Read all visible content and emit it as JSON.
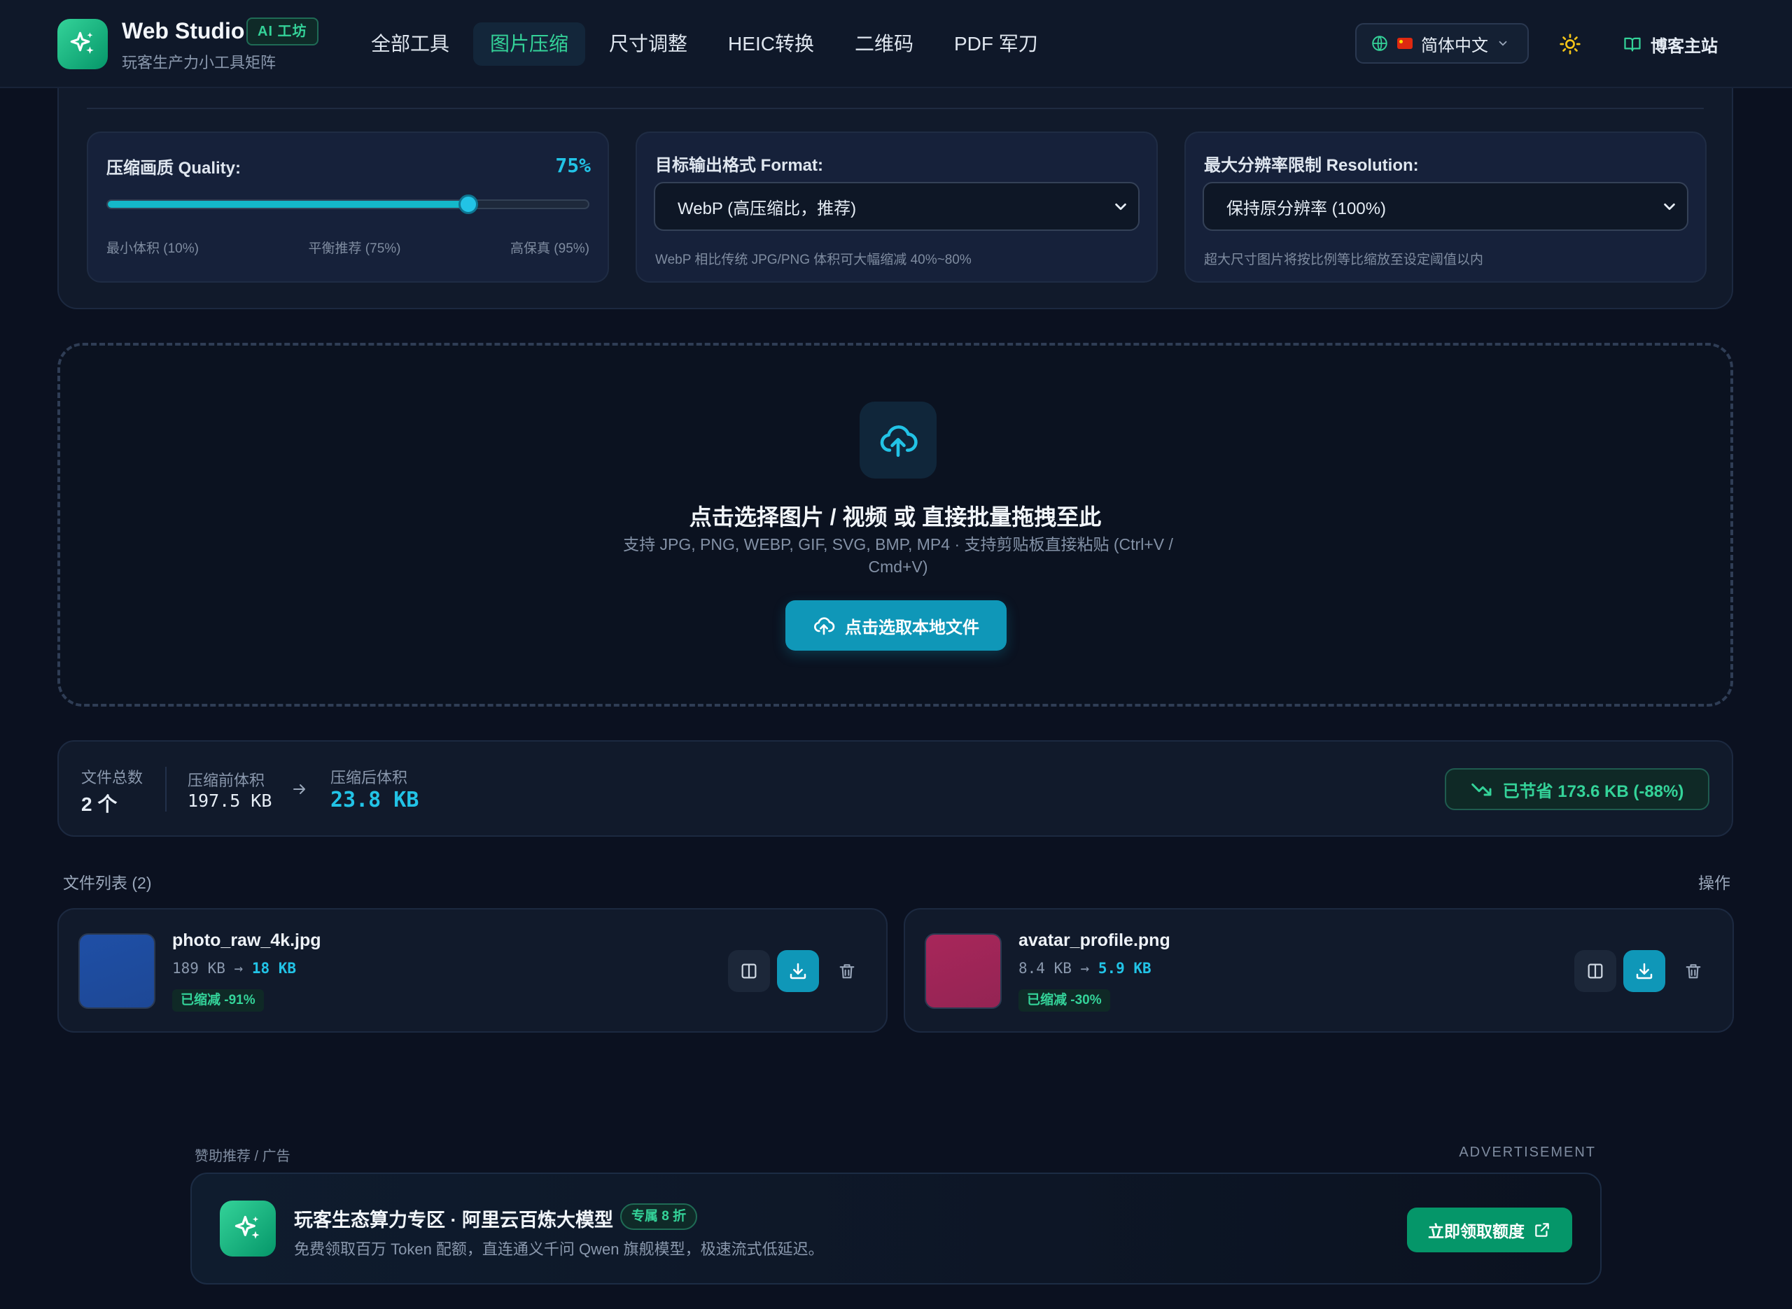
{
  "colors": {
    "background": "#0b1120",
    "accent_green": "#34d399",
    "accent_cyan": "#22c3e6",
    "primary_button": "#0f97b8"
  },
  "header": {
    "brand_title": "Web Studio",
    "brand_badge": "AI 工坊",
    "brand_subtitle": "玩客生产力小工具矩阵",
    "nav": [
      {
        "label": "全部工具",
        "active": false
      },
      {
        "label": "图片压缩",
        "active": true
      },
      {
        "label": "尺寸调整",
        "active": false
      },
      {
        "label": "HEIC转换",
        "active": false
      },
      {
        "label": "二维码",
        "active": false
      },
      {
        "label": "PDF 军刀",
        "active": false
      }
    ],
    "language": "简体中文",
    "blog_link": "博客主站"
  },
  "settings": {
    "quality": {
      "label": "压缩画质 Quality:",
      "value_text": "75%",
      "value": 75,
      "min_label": "最小体积 (10%)",
      "mid_label": "平衡推荐 (75%)",
      "max_label": "高保真 (95%)"
    },
    "format": {
      "label": "目标输出格式 Format:",
      "selected": "WebP (高压缩比，推荐)",
      "hint": "WebP 相比传统 JPG/PNG 体积可大幅缩减 40%~80%"
    },
    "resolution": {
      "label": "最大分辨率限制 Resolution:",
      "selected": "保持原分辨率 (100%)",
      "hint": "超大尺寸图片将按比例等比缩放至设定阈值以内"
    }
  },
  "dropzone": {
    "title": "点击选择图片 / 视频 或 直接批量拖拽至此",
    "subtitle": "支持 JPG, PNG, WEBP, GIF, SVG, BMP, MP4 · 支持剪贴板直接粘贴 (Ctrl+V / Cmd+V)",
    "button": "点击选取本地文件"
  },
  "stats": {
    "total_label": "文件总数",
    "total_value": "2 个",
    "before_label": "压缩前体积",
    "before_value": "197.5 KB",
    "after_label": "压缩后体积",
    "after_value": "23.8 KB",
    "saved": "已节省 173.6 KB (-88%)"
  },
  "file_list": {
    "title": "文件列表 (2)",
    "action_header": "操作",
    "files": [
      {
        "name": "photo_raw_4k.jpg",
        "original": "189 KB",
        "compressed": "18 KB",
        "reduced": "已缩减 -91%",
        "thumb_color": "#1f4fa6"
      },
      {
        "name": "avatar_profile.png",
        "original": "8.4 KB",
        "compressed": "5.9 KB",
        "reduced": "已缩减 -30%",
        "thumb_color": "#a8265a"
      }
    ]
  },
  "ad": {
    "label": "赞助推荐 / 广告",
    "tag": "ADVERTISEMENT",
    "title": "玩客生态算力专区 · 阿里云百炼大模型",
    "badge": "专属 8 折",
    "description": "免费领取百万 Token 配额，直连通义千问 Qwen 旗舰模型，极速流式低延迟。",
    "button": "立即领取额度"
  }
}
